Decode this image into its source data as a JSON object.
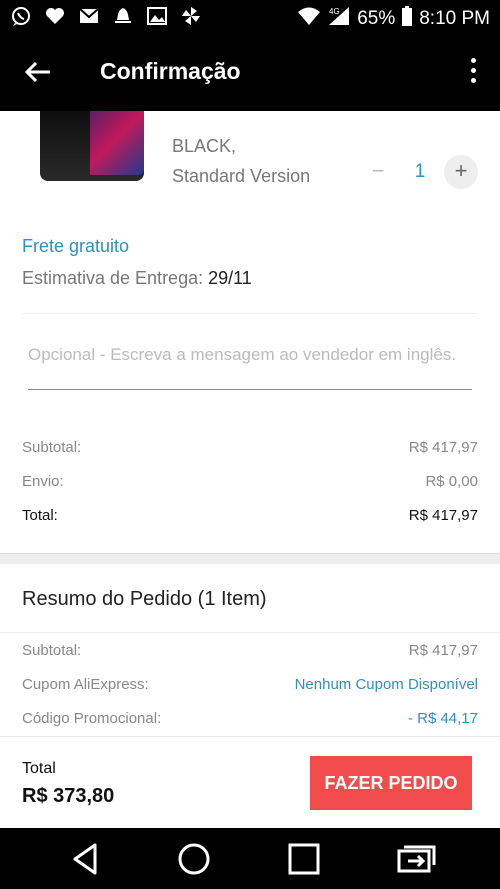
{
  "status": {
    "battery": "65%",
    "time": "8:10 PM",
    "network": "4G"
  },
  "header": {
    "title": "Confirmação"
  },
  "product": {
    "variant_color": "BLACK,",
    "variant_version": "Standard Version",
    "quantity": "1",
    "minus": "−",
    "plus": "+"
  },
  "shipping": {
    "free_label": "Frete gratuito",
    "estimate_label": "Estimativa de Entrega:",
    "estimate_date": "29/11"
  },
  "message": {
    "placeholder": "Opcional - Escreva a mensagem ao vendedor em inglês."
  },
  "item_summary": {
    "subtotal_label": "Subtotal:",
    "subtotal_value": "R$ 417,97",
    "shipping_label": "Envio:",
    "shipping_value": "R$ 0,00",
    "total_label": "Total:",
    "total_value": "R$ 417,97"
  },
  "order_summary": {
    "title": "Resumo do Pedido (1 Item)",
    "subtotal_label": "Subtotal:",
    "subtotal_value": "R$ 417,97",
    "coupon_label": "Cupom AliExpress:",
    "coupon_value": "Nenhum Cupom Disponível",
    "promo_label": "Código Promocional:",
    "promo_value": "- R$ 44,17"
  },
  "order_bar": {
    "total_label": "Total",
    "total_value": "R$ 373,80",
    "button_label": "FAZER PEDIDO"
  },
  "colors": {
    "accent_blue": "#2e90c0",
    "order_button": "#f24b4b",
    "header_bg": "#000000"
  },
  "icons": [
    "whatsapp-icon",
    "heart-icon",
    "gmail-icon",
    "notification-icon",
    "image-icon",
    "pinwheel-icon",
    "wifi-icon",
    "signal-icon",
    "battery-icon",
    "back-arrow-icon",
    "more-vert-icon",
    "nav-back-icon",
    "nav-home-icon",
    "nav-recents-icon",
    "nav-switch-icon"
  ]
}
